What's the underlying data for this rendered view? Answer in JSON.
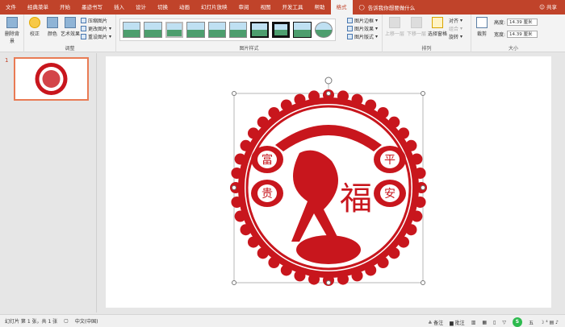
{
  "tabs": [
    "文件",
    "经典菜单",
    "开始",
    "墨迹书写",
    "插入",
    "设计",
    "切换",
    "动画",
    "幻灯片放映",
    "审阅",
    "视图",
    "开发工具",
    "帮助",
    "格式"
  ],
  "active_tab": "格式",
  "tell_me": "告诉我你想要做什么",
  "share": "共享",
  "adjust": {
    "remove_bg": "删除背景",
    "correct": "校正",
    "color": "颜色",
    "artistic": "艺术效果",
    "compress": "压缩图片",
    "change": "更改图片",
    "reset": "重设图片",
    "label": "调整"
  },
  "styles": {
    "border": "图片边框",
    "effects": "图片效果",
    "layout": "图片版式",
    "label": "图片样式"
  },
  "arrange": {
    "forward": "上移一层",
    "backward": "下移一层",
    "selection": "选择窗格",
    "align": "对齐",
    "group": "组合",
    "rotate": "旋转",
    "label": "排列"
  },
  "size": {
    "crop": "裁剪",
    "height_label": "高度:",
    "height": "14.39 厘米",
    "width_label": "宽度:",
    "width": "14.39 厘米",
    "label": "大小"
  },
  "slide_number": "1",
  "artwork": {
    "chars": [
      "富",
      "贵",
      "平",
      "安",
      "福"
    ]
  },
  "status": {
    "slide": "幻灯片 第 1 张，共 1 张",
    "lang": "中文(中国)",
    "notes": "备注",
    "comments": "批注",
    "ime": "五"
  },
  "colors": {
    "accent": "#c0432a",
    "paper_red": "#c8161d"
  }
}
